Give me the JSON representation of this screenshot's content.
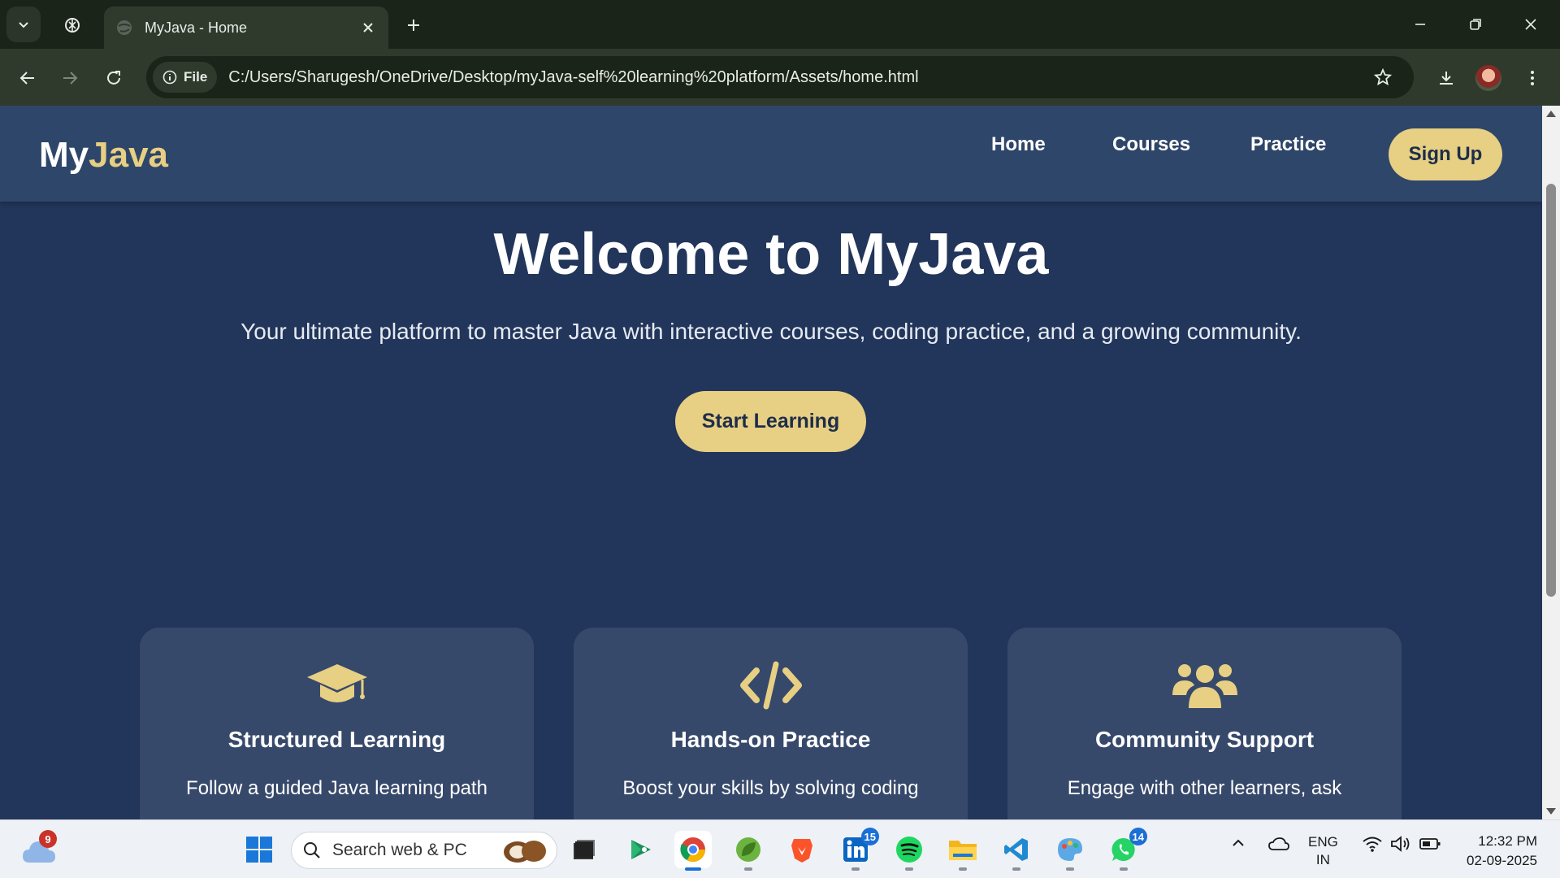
{
  "browser": {
    "tab_title": "MyJava - Home",
    "site_chip": "File",
    "url": "C:/Users/Sharugesh/OneDrive/Desktop/myJava-self%20learning%20platform/Assets/home.html"
  },
  "site": {
    "logo_main": "My",
    "logo_accent": "Java",
    "nav": {
      "home": "Home",
      "courses": "Courses",
      "practice": "Practice",
      "signup": "Sign Up"
    },
    "hero": {
      "title": "Welcome to MyJava",
      "subtitle": "Your ultimate platform to master Java with interactive courses, coding practice, and a growing community.",
      "cta": "Start Learning"
    },
    "features": [
      {
        "icon": "graduation-cap-icon",
        "title": "Structured Learning",
        "desc": "Follow a guided Java learning path"
      },
      {
        "icon": "code-icon",
        "title": "Hands-on Practice",
        "desc": "Boost your skills by solving coding"
      },
      {
        "icon": "users-icon",
        "title": "Community Support",
        "desc": "Engage with other learners, ask"
      }
    ],
    "colors": {
      "accent": "#e7cf83",
      "navbar": "#2e4669",
      "background": "#22355a",
      "card": "#37496b"
    }
  },
  "taskbar": {
    "weather_badge": "9",
    "search_placeholder": "Search web & PC",
    "linkedin_badge": "15",
    "whatsapp_badge": "14",
    "lang_line1": "ENG",
    "lang_line2": "IN",
    "time": "12:32 PM",
    "date": "02-09-2025"
  }
}
